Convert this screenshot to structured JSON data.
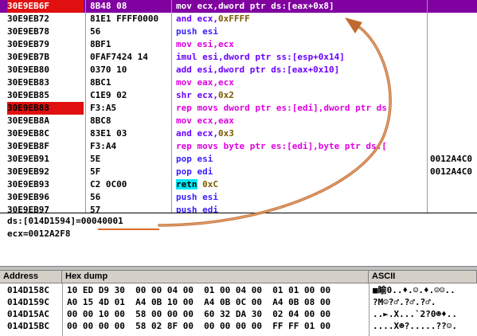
{
  "disasm": {
    "rows": [
      {
        "addr": "30E9EB6F",
        "hex": "8B48 08",
        "ins": [
          [
            "mov ecx,",
            "mov"
          ],
          [
            "dword ptr ds:[eax+0x8]",
            "mov"
          ]
        ],
        "cmt": ""
      },
      {
        "addr": "30E9EB72",
        "hex": "81E1 FFFF0000",
        "ins": [
          [
            "and ecx,",
            "ar"
          ],
          [
            "0xFFFF",
            "imm"
          ]
        ],
        "cmt": ""
      },
      {
        "addr": "30E9EB78",
        "hex": "56",
        "ins": [
          [
            "push esi",
            "pp"
          ]
        ],
        "cmt": ""
      },
      {
        "addr": "30E9EB79",
        "hex": "8BF1",
        "ins": [
          [
            "mov esi,ecx",
            "mov"
          ]
        ],
        "cmt": ""
      },
      {
        "addr": "30E9EB7B",
        "hex": "0FAF7424 14",
        "ins": [
          [
            "imul esi,dword ptr ss:[esp+0x14]",
            "ar"
          ]
        ],
        "cmt": ""
      },
      {
        "addr": "30E9EB80",
        "hex": "0370 10",
        "ins": [
          [
            "add esi,dword ptr ds:[eax+0x10]",
            "ar"
          ]
        ],
        "cmt": ""
      },
      {
        "addr": "30E9EB83",
        "hex": "8BC1",
        "ins": [
          [
            "mov eax,ecx",
            "mov"
          ]
        ],
        "cmt": ""
      },
      {
        "addr": "30E9EB85",
        "hex": "C1E9 02",
        "ins": [
          [
            "shr ecx,",
            "ar"
          ],
          [
            "0x2",
            "imm"
          ]
        ],
        "cmt": ""
      },
      {
        "addr": "30E9EB88",
        "hex": "F3:A5",
        "ins": [
          [
            "rep movs dword ptr es:[edi],dword ptr ds",
            "mov"
          ]
        ],
        "cmt": "",
        "bp": true
      },
      {
        "addr": "30E9EB8A",
        "hex": "8BC8",
        "ins": [
          [
            "mov ecx,eax",
            "mov"
          ]
        ],
        "cmt": ""
      },
      {
        "addr": "30E9EB8C",
        "hex": "83E1 03",
        "ins": [
          [
            "and ecx,",
            "ar"
          ],
          [
            "0x3",
            "imm"
          ]
        ],
        "cmt": ""
      },
      {
        "addr": "30E9EB8F",
        "hex": "F3:A4",
        "ins": [
          [
            "rep movs byte ptr es:[edi],byte ptr ds:[",
            "mov"
          ]
        ],
        "cmt": ""
      },
      {
        "addr": "30E9EB91",
        "hex": "5E",
        "ins": [
          [
            "pop esi",
            "pp"
          ]
        ],
        "cmt": "0012A4C0"
      },
      {
        "addr": "30E9EB92",
        "hex": "5F",
        "ins": [
          [
            "pop edi",
            "pp"
          ]
        ],
        "cmt": "0012A4C0"
      },
      {
        "addr": "30E9EB93",
        "hex": "C2 0C00",
        "ins": [
          [
            "retn",
            "ret"
          ],
          [
            " 0xC",
            "imm"
          ]
        ],
        "cmt": ""
      },
      {
        "addr": "30E9EB96",
        "hex": "56",
        "ins": [
          [
            "push esi",
            "pp"
          ]
        ],
        "cmt": ""
      },
      {
        "addr": "30E9EB97",
        "hex": "57",
        "ins": [
          [
            "push edi",
            "pp"
          ]
        ],
        "cmt": ""
      }
    ]
  },
  "info": {
    "line1": "ds:[014D1594]=00040001",
    "line2": "ecx=0012A2F8"
  },
  "dump": {
    "headers": {
      "address": "Address",
      "hex": "Hex dump",
      "ascii": "ASCII"
    },
    "rows": [
      {
        "addr": "014D158C",
        "hex": "10 ED D9 30  00 00 04 00  01 00 04 00  01 01 00 00",
        "ascii": "■睮0..♦.☺.♦.☺☺.."
      },
      {
        "addr": "014D159C",
        "hex": "A0 15 4D 01  A4 0B 10 00  A4 0B 0C 00  A4 0B 08 00",
        "ascii": "?M☺?♂.?♂.?♂."
      },
      {
        "addr": "014D15AC",
        "hex": "00 00 10 00  58 00 00 00  60 32 DA 30  02 04 00 00",
        "ascii": "..►.X...`2?0☻♦.."
      },
      {
        "addr": "014D15BC",
        "hex": "00 00 00 00  58 02 8F 00  00 00 00 00  FF FF 01 00",
        "ascii": "....X☻?.....??☺."
      }
    ]
  }
}
